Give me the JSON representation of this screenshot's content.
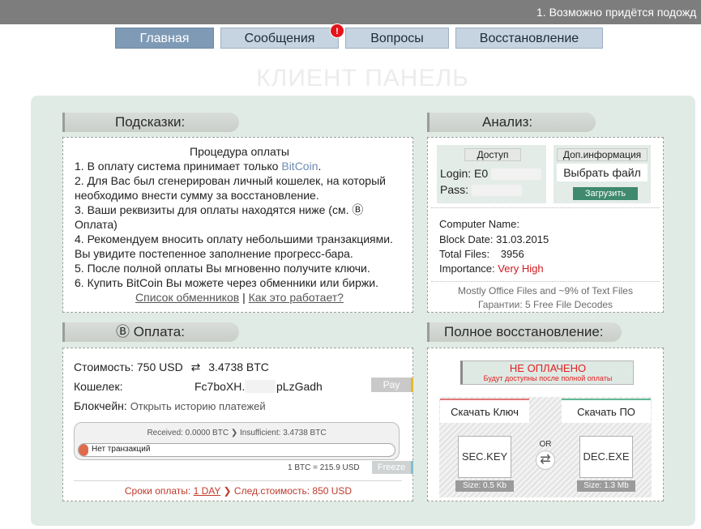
{
  "ticker": {
    "text": "1. Возможно придётся подожд"
  },
  "nav": {
    "items": [
      {
        "label": "Главная"
      },
      {
        "label": "Сообщения"
      },
      {
        "label": "Вопросы"
      },
      {
        "label": "Восстановление"
      }
    ],
    "badge": "!"
  },
  "page_title": "КЛИЕНТ ПАНЕЛЬ",
  "hints": {
    "title": "Подсказки:",
    "heading": "Процедура оплаты",
    "line1_prefix": "1. В оплату система принимает только ",
    "line1_btc": "BitCoin",
    "line1_suffix": ".",
    "line2": "2. Для Вас был сгенерирован личный кошелек, на который необходимо внести сумму за восстановление.",
    "line3": "3. Ваши реквизиты для оплаты находятся ниже (см. Ⓑ Оплата)",
    "line4": "4. Рекомендуем вносить оплату небольшими транзакциями. Вы увидите постепенное заполнение прогресс-бара.",
    "line5": "5. После полной оплаты Вы мгновенно получите ключи.",
    "line6": "6. Купить BitCoin Вы можете через обменники или биржи.",
    "link_exchangers": "Список обменников",
    "separator": "|",
    "link_how": "Как это работает?"
  },
  "analysis": {
    "title": "Анализ:",
    "access_head": "Доступ",
    "login_label": "Login:",
    "login_value": "E0",
    "pass_label": "Pass:",
    "extra_head": "Доп.информация",
    "choose_file": "Выбрать файл",
    "upload_btn": "Загрузить",
    "computer_name_label": "Computer Name:",
    "block_date_label": "Block Date:",
    "block_date_value": "31.03.2015",
    "total_files_label": "Total Files:",
    "total_files_value": "3956",
    "importance_label": "Importance:",
    "importance_value": "Very High",
    "note1": "Mostly Office Files and ~9% of Text Files",
    "note2": "Гарантии: 5 Free File Decodes"
  },
  "payment": {
    "title": "Ⓑ Оплата:",
    "cost_label": "Стоимость: 750 USD",
    "swap_glyph": "⇄",
    "cost_btc": "3.4738 BTC",
    "wallet_label": "Кошелек:",
    "wallet_part1": "Fc7boXH.",
    "wallet_part2": "pLzGadh",
    "pay_btn": "Pay",
    "blockchain_label": "Блокчейн:",
    "blockchain_link": "Открыть историю платежей",
    "received": "Received: 0.0000 BTC",
    "insufficient": "Insufficient: 3.4738 BTC",
    "progress_label": "Нет транзакций",
    "progress_fraction": 0.03,
    "rate": "1 BTC = 215.9 USD",
    "freeze_btn": "Freeze",
    "deadline_label": "Сроки оплаты:",
    "deadline_value": "1 DAY",
    "next_cost": "След.стоимость: 850 USD"
  },
  "recovery": {
    "title": "Полное восстановление:",
    "status": "НЕ ОПЛАЧЕНО",
    "status_sub": "Будут доступны после полной оплаты",
    "key_head": "Скачать Ключ",
    "key_file": "SEC.KEY",
    "key_size": "Size: 0.5 Kb",
    "or_label": "OR",
    "swap_glyph": "⇄",
    "exe_head": "Скачать ПО",
    "exe_file": "DEC.EXE",
    "exe_size": "Size: 1.3 Mb"
  },
  "colors": {
    "nav_active": "#7f9ab5",
    "nav_inactive": "#c6d3e0",
    "panel_bg": "#e1ebe5",
    "btc_link": "#6d8bb3",
    "alert_red": "#e4121a",
    "upload_green": "#3f8a6e",
    "key_accent": "#e07a7a",
    "exe_accent": "#5fb894"
  }
}
